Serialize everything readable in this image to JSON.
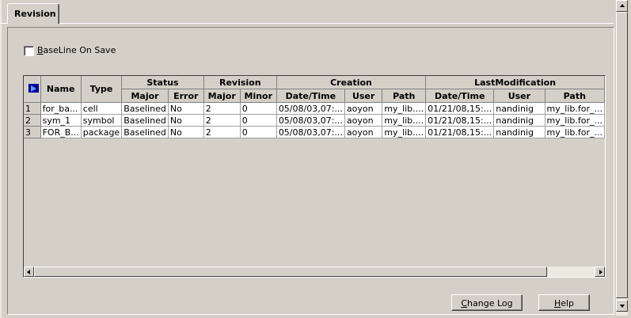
{
  "tab": {
    "label": "Revision"
  },
  "baseline": {
    "label": "BaseLine On Save",
    "checked": false
  },
  "grid": {
    "headers": {
      "name": "Name",
      "type": "Type",
      "status": "Status",
      "revision": "Revision",
      "creation": "Creation",
      "last_modification": "LastModification",
      "status_major": "Major",
      "status_error": "Error",
      "revision_major": "Major",
      "revision_minor": "Minor",
      "creation_datetime": "Date/Time",
      "creation_user": "User",
      "creation_path": "Path",
      "lastmod_datetime": "Date/Time",
      "lastmod_user": "User",
      "lastmod_path": "Path"
    },
    "rows": [
      {
        "num": "1",
        "name": "for_ba...",
        "type": "cell",
        "status_major": "Baselined",
        "status_error": "No",
        "rev_major": "2",
        "rev_minor": "0",
        "cr_datetime": "05/08/03,07:...",
        "cr_user": "aoyon",
        "cr_path": "my_lib....",
        "lm_datetime": "01/21/08,15:...",
        "lm_user": "nandinig",
        "lm_path": "my_lib.for_..."
      },
      {
        "num": "2",
        "name": "sym_1",
        "type": "symbol",
        "status_major": "Baselined",
        "status_error": "No",
        "rev_major": "2",
        "rev_minor": "0",
        "cr_datetime": "05/08/03,07:...",
        "cr_user": "aoyon",
        "cr_path": "my_lib....",
        "lm_datetime": "01/21/08,15:...",
        "lm_user": "nandinig",
        "lm_path": "my_lib.for_..."
      },
      {
        "num": "3",
        "name": "FOR_B...",
        "type": "package",
        "status_major": "Baselined",
        "status_error": "No",
        "rev_major": "2",
        "rev_minor": "0",
        "cr_datetime": "05/08/03,07:...",
        "cr_user": "aoyon",
        "cr_path": "my_lib....",
        "lm_datetime": "01/21/08,15:...",
        "lm_user": "nandinig",
        "lm_path": "my_lib.for_..."
      }
    ]
  },
  "buttons": {
    "change_log": "Change Log",
    "help": "Help"
  },
  "icons": {
    "corner": "select-all-arrow-icon"
  }
}
